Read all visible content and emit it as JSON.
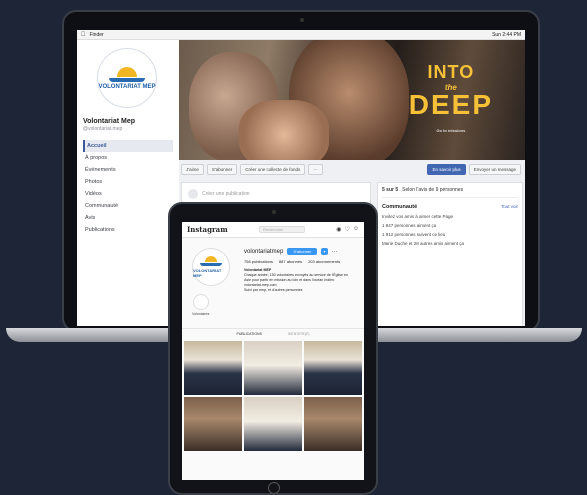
{
  "mac": {
    "app": "Finder",
    "clock": "Sun 2:44 PM"
  },
  "facebook": {
    "page_name": "Volontariat Mep",
    "page_handle": "@volontariat.mep",
    "logo_text": "VOLONTARIAT MEP",
    "nav": [
      "Accueil",
      "À propos",
      "Événements",
      "Photos",
      "Vidéos",
      "Communauté",
      "Avis",
      "Publications"
    ],
    "cover": {
      "line1": "INTO",
      "the": "the",
      "line2": "DEEP",
      "sub": "Go to missions"
    },
    "actions": {
      "like": "J'aime",
      "subscribe": "S'abonner",
      "collect": "Créer une collecte de fonds",
      "more": "···",
      "learn_more": "En savoir plus",
      "message": "Envoyer un message"
    },
    "composer_placeholder": "Créer une publication",
    "right": {
      "rating": "5 sur 5",
      "rating_detail": "Selon l'avis de 9 personnes",
      "community_title": "Communauté",
      "see_all": "Tout voir",
      "line1": "Invitez vos amis à aimer cette Page",
      "line2": "1 847 personnes aiment ça",
      "line3": "1 912 personnes suivent ce lieu",
      "line4": "Marie Duche et 28 autres amis aiment ça"
    }
  },
  "instagram": {
    "brand": "Instagram",
    "search_placeholder": "Rechercher",
    "username": "volontariatmep",
    "follow": "S'abonner",
    "stats": [
      "756 publications",
      "887 abonnés",
      "203 abonnements"
    ],
    "bio_name": "Volontariat MEP",
    "bio_lines": [
      "Chaque année, 150 volontaires envoyés au service de l'Église en",
      "Asie pour partir en mission au loin et dans l'océan Indien.",
      "volontariat-mep.com"
    ],
    "followed_by": "Suivi par mep, et d'autres personnes",
    "highlight_label": "Volontaires",
    "tabs": [
      "PUBLICATIONS",
      "IDENTIFIÉ(E)"
    ]
  }
}
